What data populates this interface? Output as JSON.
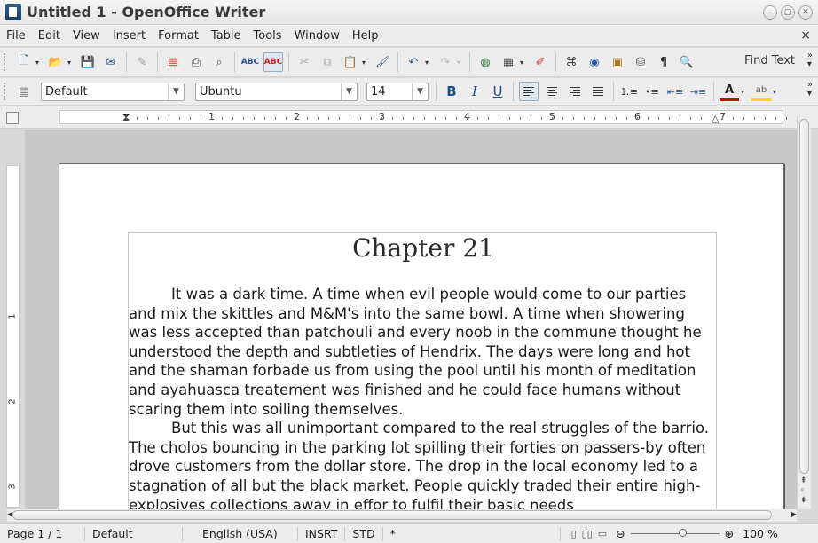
{
  "window": {
    "title": "Untitled 1 - OpenOffice Writer"
  },
  "menubar": {
    "items": [
      "File",
      "Edit",
      "View",
      "Insert",
      "Format",
      "Table",
      "Tools",
      "Window",
      "Help"
    ],
    "close_glyph": "×"
  },
  "toolbar_standard": {
    "find_text_label": "Find Text",
    "icons": [
      "new-icon",
      "open-icon",
      "save-icon",
      "email-icon",
      "edit-mode-icon",
      "export-pdf-icon",
      "print-icon",
      "print-preview-icon",
      "spellcheck-icon",
      "autospellcheck-icon",
      "cut-icon",
      "copy-icon",
      "paste-icon",
      "clone-format-icon",
      "undo-icon",
      "redo-icon",
      "hyperlink-icon",
      "table-icon",
      "draw-icon",
      "find-replace-icon",
      "navigator-icon",
      "gallery-icon",
      "data-sources-icon",
      "nonprinting-chars-icon",
      "zoom-icon"
    ]
  },
  "toolbar_formatting": {
    "paragraph_style": "Default",
    "font_name": "Ubuntu",
    "font_size": "14",
    "bold": "B",
    "italic": "I",
    "underline": "U"
  },
  "ruler": {
    "h_numbers": [
      "1",
      "2",
      "3",
      "4",
      "5",
      "6",
      "7"
    ],
    "v_numbers": [
      "1",
      "2",
      "3"
    ]
  },
  "document": {
    "chapter_title": "Chapter 21",
    "paragraphs": [
      "It was a dark time.  A time when evil people would come to our parties and mix the skittles and M&M's into the same bowl.  A time when showering was less accepted than patchouli and every noob in the commune thought he understood the depth and subtleties of Hendrix.  The days were long and hot and the shaman forbade us from using the pool until his month of meditation and ayahuasca treatement was finished and he could face humans without scaring them into soiling themselves.",
      "But this was all unimportant compared to the real struggles of the barrio.  The cholos bouncing in the parking lot spilling their forties on passers-by often drove customers from the dollar store.  The drop in the local economy led to a stagnation of all but the black market.  People quickly traded their entire high-explosives collections away in effor to fulfil their basic needs"
    ]
  },
  "statusbar": {
    "page": "Page 1 / 1",
    "style": "Default",
    "language": "English (USA)",
    "insert_mode": "INSRT",
    "selection_mode": "STD",
    "modified": "*",
    "zoom": "100 %"
  }
}
